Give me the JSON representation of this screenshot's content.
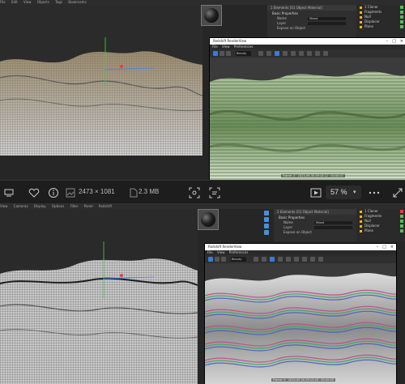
{
  "top_app": {
    "menubar": [
      "File",
      "Edit",
      "View",
      "Objects",
      "Tags",
      "Bookmarks"
    ],
    "attributes": {
      "header": "1 Elements [01 Object Material]",
      "tabs": "Basic Properties",
      "rows": [
        {
          "label": "Name",
          "value": "Mixed"
        },
        {
          "label": "Layer",
          "value": ""
        },
        {
          "label": "Expose on Object",
          "value": ""
        }
      ]
    },
    "objects": [
      "1 Cloner",
      "Fragments",
      "Null",
      "Displacer",
      "Plane"
    ],
    "render_view": {
      "title": "Redshift RenderView",
      "menu": [
        "File",
        "View",
        "Preferences"
      ],
      "select_label": "Beauty",
      "caption": "Frame: 0 · 2025-09-30 09:10:12 · 00:00:07"
    }
  },
  "bottom_app": {
    "menubar": [
      "View",
      "Cameras",
      "Display",
      "Options",
      "Filter",
      "Panel",
      "Redshift"
    ],
    "attributes": {
      "header": "2 Elements [01 Object Material]",
      "tabs": "Basic Properties",
      "rows": [
        {
          "label": "Name",
          "value": "Mixed"
        },
        {
          "label": "Layer",
          "value": ""
        },
        {
          "label": "Expose on Object",
          "value": ""
        }
      ]
    },
    "objects": [
      "1 Cloner",
      "Fragments",
      "Null",
      "Displacer",
      "Plane"
    ],
    "render_view": {
      "title": "Redshift RenderView",
      "menu": [
        "File",
        "View",
        "Preferences"
      ],
      "select_label": "Beauty",
      "caption": "Frame: 0 · 2025-09-30 09:12:40 · 00:00:09"
    }
  },
  "viewer_toolbar": {
    "dimensions": "2473 × 1081",
    "file_size": "2.3 MB",
    "zoom": "57 %",
    "icons": [
      "monitor-icon",
      "heart-icon",
      "info-icon",
      "image-icon",
      "focus-icon",
      "scan-text-icon",
      "slideshow-icon",
      "more-icon",
      "expand-icon"
    ]
  }
}
